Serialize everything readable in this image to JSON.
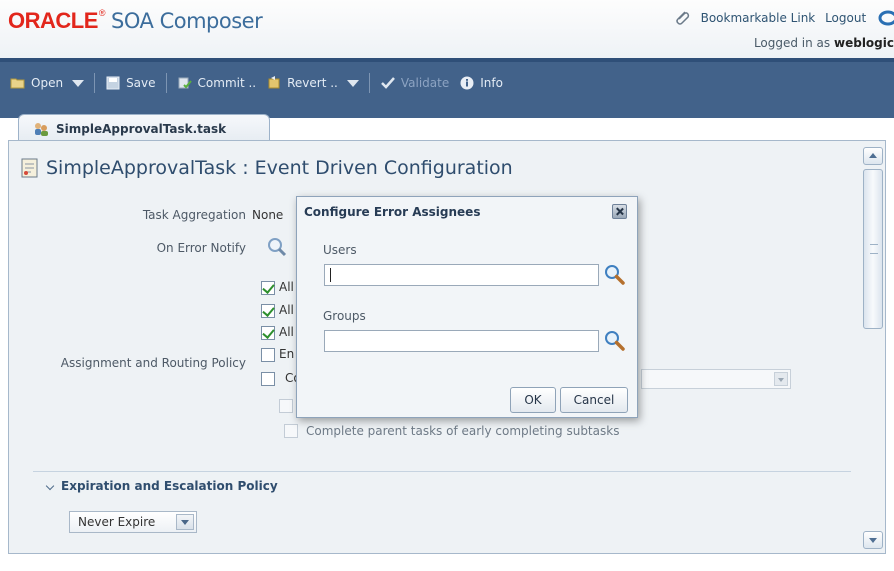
{
  "header": {
    "logo_brand": "ORACLE",
    "logo_tm": "®",
    "app_name": "SOA Composer",
    "bookmarkable_link": "Bookmarkable Link",
    "logout": "Logout",
    "logged_in_prefix": "Logged in as",
    "username": "weblogic"
  },
  "toolbar": {
    "open_label": "Open",
    "save_label": "Save",
    "commit_label": "Commit ..",
    "revert_label": "Revert ..",
    "validate_label": "Validate",
    "info_label": "Info"
  },
  "tab": {
    "label": "SimpleApprovalTask.task"
  },
  "page": {
    "title": "SimpleApprovalTask : Event Driven Configuration",
    "task_aggregation_label": "Task Aggregation",
    "task_aggregation_value": "None",
    "on_error_notify_label": "On Error Notify",
    "assignment_label": "Assignment and Routing Policy",
    "options": [
      {
        "text": "All",
        "checked": true
      },
      {
        "text": "All",
        "checked": true
      },
      {
        "text": "All",
        "checked": true
      },
      {
        "text": "En",
        "checked": false
      },
      {
        "text": "Co",
        "checked": false
      }
    ],
    "complete_parent_label": "Complete parent tasks of early completing subtasks",
    "expiration_section_title": "Expiration and Escalation Policy",
    "expiration_select_value": "Never Expire"
  },
  "dialog": {
    "title": "Configure Error Assignees",
    "users_label": "Users",
    "users_value": "",
    "groups_label": "Groups",
    "groups_value": "",
    "ok_label": "OK",
    "cancel_label": "Cancel"
  },
  "colors": {
    "oracle_red": "#e2261c",
    "toolbar_blue": "#42628a",
    "title_blue": "#2f4d6e",
    "panel_bg": "#eef2f5"
  }
}
